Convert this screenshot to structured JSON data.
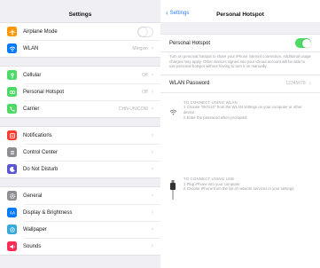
{
  "settings": {
    "title": "Settings",
    "groups": [
      [
        {
          "label": "Airplane Mode",
          "icon": "airplane-icon",
          "color": "#ff9500",
          "control": "toggle-off"
        },
        {
          "label": "WLAN",
          "icon": "wifi-icon",
          "color": "#007aff",
          "value": "Mingxin"
        }
      ],
      [
        {
          "label": "Cellular",
          "icon": "antenna-icon",
          "color": "#4cd964",
          "value": "Off"
        },
        {
          "label": "Personal Hotspot",
          "icon": "hotspot-icon",
          "color": "#4cd964",
          "value": "Off"
        },
        {
          "label": "Carrier",
          "icon": "phone-icon",
          "color": "#4cd964",
          "value": "CHN-UNICOM"
        }
      ],
      [
        {
          "label": "Notifications",
          "icon": "notifications-icon",
          "color": "#ff3b30"
        },
        {
          "label": "Control Center",
          "icon": "control-center-icon",
          "color": "#8e8e93"
        },
        {
          "label": "Do Not Disturb",
          "icon": "moon-icon",
          "color": "#5856d6"
        }
      ],
      [
        {
          "label": "General",
          "icon": "gear-icon",
          "color": "#8e8e93"
        },
        {
          "label": "Display & Brightness",
          "icon": "brightness-icon",
          "color": "#007aff"
        },
        {
          "label": "Wallpaper",
          "icon": "wallpaper-icon",
          "color": "#34aadc"
        },
        {
          "label": "Sounds",
          "icon": "speaker-icon",
          "color": "#ff2d55"
        }
      ]
    ]
  },
  "hotspot": {
    "back_label": "Settings",
    "title": "Personal Hotspot",
    "toggle_label": "Personal Hotspot",
    "toggle_on": true,
    "description": "Turn on personal hotspot to share your iPhone internet connection. Additional usage charges may apply. Other devices signed into your iCloud account will be able to use personal hotspot without having to turn it on manually.",
    "password_label": "WLAN Password",
    "password_value": "12345678",
    "wlan_heading": "TO CONNECT USING WLAN",
    "wlan_step1": "1 Choose \"8k7s10\" from the WLAN settings on your computer or other device.",
    "wlan_step2": "2 Enter the password when prompted.",
    "usb_heading": "TO CONNECT USING USB",
    "usb_step1": "1 Plug iPhone into your computer.",
    "usb_step2": "2 Choose iPhone from the list of network services in your settings."
  }
}
